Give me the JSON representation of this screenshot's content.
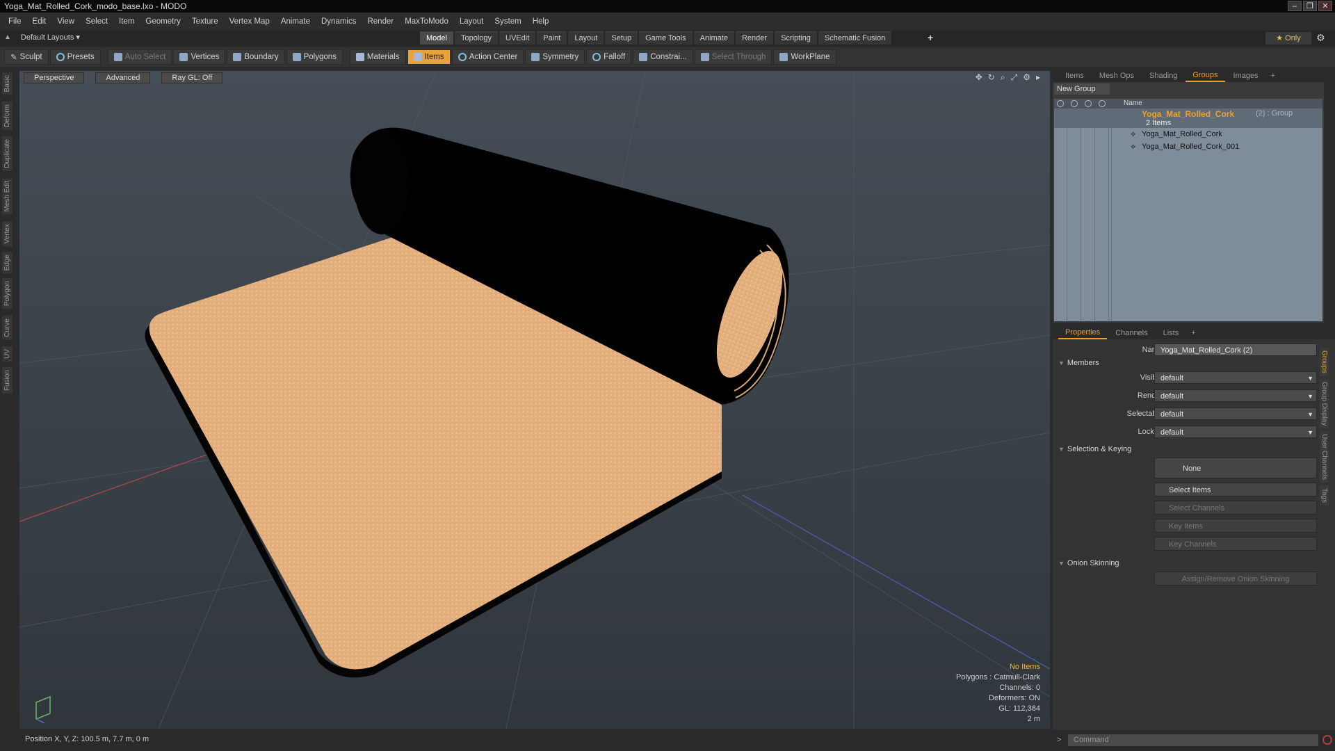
{
  "window": {
    "title": "Yoga_Mat_Rolled_Cork_modo_base.lxo - MODO"
  },
  "menu": [
    "File",
    "Edit",
    "View",
    "Select",
    "Item",
    "Geometry",
    "Texture",
    "Vertex Map",
    "Animate",
    "Dynamics",
    "Render",
    "MaxToModo",
    "Layout",
    "System",
    "Help"
  ],
  "layout": {
    "label": "Default Layouts ▾"
  },
  "layout_tabs": [
    "Model",
    "Topology",
    "UVEdit",
    "Paint",
    "Layout",
    "Setup",
    "Game Tools",
    "Animate",
    "Render",
    "Scripting",
    "Schematic Fusion"
  ],
  "only_label": "★ Only",
  "toolbar": {
    "sculpt": "Sculpt",
    "presets": "Presets",
    "auto_select": "Auto Select",
    "vertices": "Vertices",
    "boundary": "Boundary",
    "polygons": "Polygons",
    "materials": "Materials",
    "items": "Items",
    "action_center": "Action Center",
    "symmetry": "Symmetry",
    "falloff": "Falloff",
    "constraints": "Constrai...",
    "select_through": "Select Through",
    "workplane": "WorkPlane"
  },
  "left_tabs": [
    "Basic",
    "Deform",
    "Duplicate",
    "Mesh Edit",
    "Vertex",
    "Edge",
    "Polygon",
    "Curve",
    "UV",
    "Fusion"
  ],
  "viewport": {
    "perspective": "Perspective",
    "advanced": "Advanced",
    "raygl": "Ray GL: Off",
    "info": {
      "no_items": "No Items",
      "polygons": "Polygons : Catmull-Clark",
      "channels": "Channels: 0",
      "deformers": "Deformers: ON",
      "gl": "GL: 112,384",
      "scale": "2 m"
    }
  },
  "status": {
    "position": "Position X, Y, Z:  100.5 m, 7.7 m, 0 m"
  },
  "top_tabs": [
    "Items",
    "Mesh Ops",
    "Shading",
    "Groups",
    "Images"
  ],
  "groups": {
    "new_group": "New Group",
    "col_name": "Name",
    "group_name": "Yoga_Mat_Rolled_Cork",
    "group_suffix": "(2) : Group",
    "count": "2 Items",
    "children": [
      "Yoga_Mat_Rolled_Cork",
      "Yoga_Mat_Rolled_Cork_001"
    ]
  },
  "prop_tabs": [
    "Properties",
    "Channels",
    "Lists"
  ],
  "properties": {
    "name_label": "Name",
    "name_value": "Yoga_Mat_Rolled_Cork (2)",
    "members": "Members",
    "visible_label": "Visible",
    "visible_value": "default",
    "render_label": "Render",
    "render_value": "default",
    "selectable_label": "Selectable",
    "selectable_value": "default",
    "locked_label": "Locked",
    "locked_value": "default",
    "selection_keying": "Selection & Keying",
    "none_btn": "None",
    "select_items": "Select Items",
    "select_channels": "Select Channels",
    "key_items": "Key Items",
    "key_channels": "Key Channels",
    "onion": "Onion Skinning",
    "assign_onion": "Assign/Remove Onion Skinning"
  },
  "right_vtabs": [
    "Groups",
    "Group Display",
    "User Channels",
    "Tags"
  ],
  "command": {
    "placeholder": "Command"
  }
}
